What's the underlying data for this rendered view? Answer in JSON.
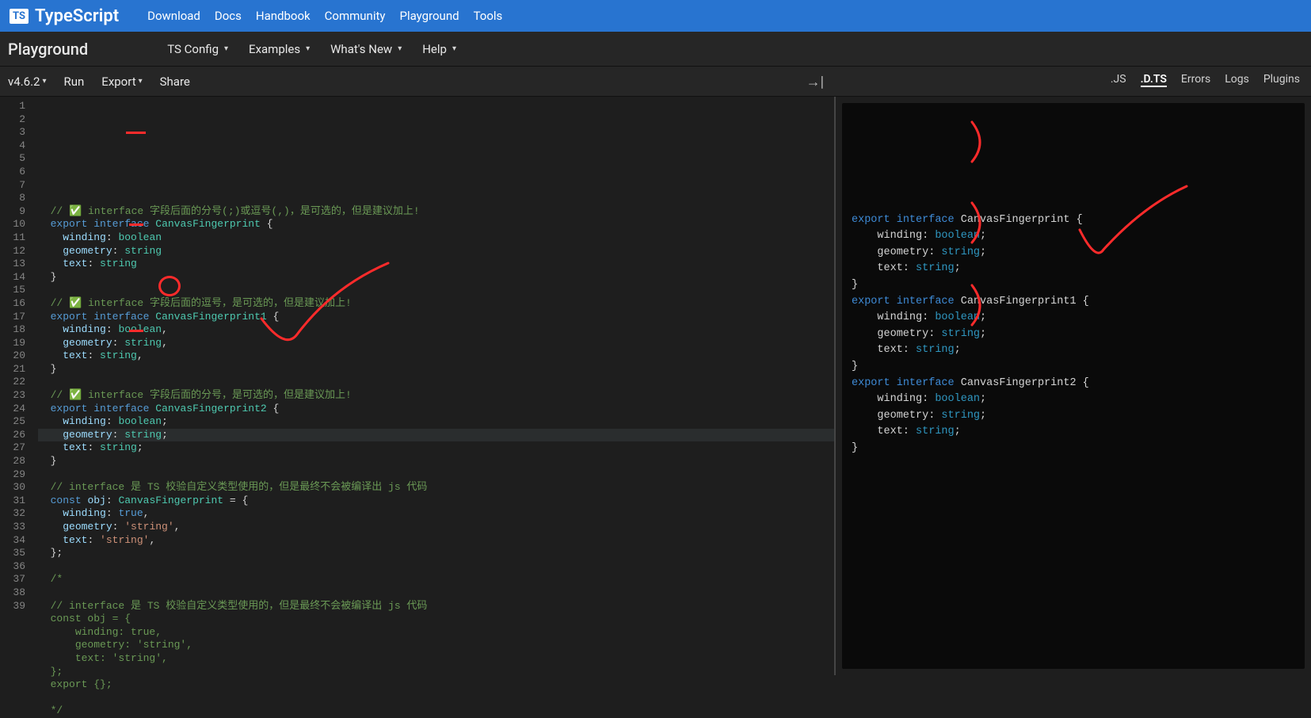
{
  "topnav": {
    "brand": "TypeScript",
    "logo": "TS",
    "links": [
      "Download",
      "Docs",
      "Handbook",
      "Community",
      "Playground",
      "Tools"
    ]
  },
  "subnav": {
    "title": "Playground",
    "items": [
      {
        "label": "TS Config",
        "caret": true
      },
      {
        "label": "Examples",
        "caret": true
      },
      {
        "label": "What's New",
        "caret": true
      },
      {
        "label": "Help",
        "caret": true
      }
    ]
  },
  "toolbar": {
    "version": "v4.6.2",
    "run": "Run",
    "export": "Export",
    "share": "Share"
  },
  "outputTabs": [
    ".JS",
    ".D.TS",
    "Errors",
    "Logs",
    "Plugins"
  ],
  "activeOutputTab": 1,
  "editor": {
    "currentLine": 18,
    "lines": [
      {
        "n": 1,
        "tokens": [
          [
            "  ",
            "p"
          ],
          [
            "// ✅ interface 字段后面的分号(;)或逗号(,)，是可选的，但是建议加上!",
            "comment"
          ]
        ]
      },
      {
        "n": 2,
        "tokens": [
          [
            "  ",
            "p"
          ],
          [
            "export",
            "keyword"
          ],
          [
            " ",
            "p"
          ],
          [
            "interface",
            "keyword"
          ],
          [
            " ",
            "p"
          ],
          [
            "CanvasFingerprint",
            "type"
          ],
          [
            " {",
            "p"
          ]
        ]
      },
      {
        "n": 3,
        "tokens": [
          [
            "    ",
            "p"
          ],
          [
            "winding",
            "prop"
          ],
          [
            ": ",
            "p"
          ],
          [
            "boolean",
            "type"
          ]
        ]
      },
      {
        "n": 4,
        "tokens": [
          [
            "    ",
            "p"
          ],
          [
            "geometry",
            "prop"
          ],
          [
            ": ",
            "p"
          ],
          [
            "string",
            "type"
          ]
        ]
      },
      {
        "n": 5,
        "tokens": [
          [
            "    ",
            "p"
          ],
          [
            "text",
            "prop"
          ],
          [
            ": ",
            "p"
          ],
          [
            "string",
            "type"
          ]
        ]
      },
      {
        "n": 6,
        "tokens": [
          [
            "  }",
            "p"
          ]
        ]
      },
      {
        "n": 7,
        "tokens": [
          [
            "",
            "p"
          ]
        ]
      },
      {
        "n": 8,
        "tokens": [
          [
            "  ",
            "p"
          ],
          [
            "// ✅ interface 字段后面的逗号，是可选的，但是建议加上!",
            "comment"
          ]
        ]
      },
      {
        "n": 9,
        "tokens": [
          [
            "  ",
            "p"
          ],
          [
            "export",
            "keyword"
          ],
          [
            " ",
            "p"
          ],
          [
            "interface",
            "keyword"
          ],
          [
            " ",
            "p"
          ],
          [
            "CanvasFingerprint1",
            "type"
          ],
          [
            " {",
            "p"
          ]
        ]
      },
      {
        "n": 10,
        "tokens": [
          [
            "    ",
            "p"
          ],
          [
            "winding",
            "prop"
          ],
          [
            ": ",
            "p"
          ],
          [
            "boolean",
            "type"
          ],
          [
            ",",
            "p"
          ]
        ]
      },
      {
        "n": 11,
        "tokens": [
          [
            "    ",
            "p"
          ],
          [
            "geometry",
            "prop"
          ],
          [
            ": ",
            "p"
          ],
          [
            "string",
            "type"
          ],
          [
            ",",
            "p"
          ]
        ]
      },
      {
        "n": 12,
        "tokens": [
          [
            "    ",
            "p"
          ],
          [
            "text",
            "prop"
          ],
          [
            ": ",
            "p"
          ],
          [
            "string",
            "type"
          ],
          [
            ",",
            "p"
          ]
        ]
      },
      {
        "n": 13,
        "tokens": [
          [
            "  }",
            "p"
          ]
        ]
      },
      {
        "n": 14,
        "tokens": [
          [
            "",
            "p"
          ]
        ]
      },
      {
        "n": 15,
        "tokens": [
          [
            "  ",
            "p"
          ],
          [
            "// ✅ interface 字段后面的分号，是可选的，但是建议加上!",
            "comment"
          ]
        ]
      },
      {
        "n": 16,
        "tokens": [
          [
            "  ",
            "p"
          ],
          [
            "export",
            "keyword"
          ],
          [
            " ",
            "p"
          ],
          [
            "interface",
            "keyword"
          ],
          [
            " ",
            "p"
          ],
          [
            "CanvasFingerprint2",
            "type"
          ],
          [
            " {",
            "p"
          ]
        ]
      },
      {
        "n": 17,
        "tokens": [
          [
            "    ",
            "p"
          ],
          [
            "winding",
            "prop"
          ],
          [
            ": ",
            "p"
          ],
          [
            "boolean",
            "type"
          ],
          [
            ";",
            "p"
          ]
        ]
      },
      {
        "n": 18,
        "tokens": [
          [
            "    ",
            "p"
          ],
          [
            "geometry",
            "prop"
          ],
          [
            ": ",
            "p"
          ],
          [
            "string",
            "type"
          ],
          [
            ";",
            "p"
          ]
        ]
      },
      {
        "n": 19,
        "tokens": [
          [
            "    ",
            "p"
          ],
          [
            "text",
            "prop"
          ],
          [
            ": ",
            "p"
          ],
          [
            "string",
            "type"
          ],
          [
            ";",
            "p"
          ]
        ]
      },
      {
        "n": 20,
        "tokens": [
          [
            "  }",
            "p"
          ]
        ]
      },
      {
        "n": 21,
        "tokens": [
          [
            "",
            "p"
          ]
        ]
      },
      {
        "n": 22,
        "tokens": [
          [
            "  ",
            "p"
          ],
          [
            "// interface 是 TS 校验自定义类型使用的，但是最终不会被编译出 js 代码",
            "comment"
          ]
        ]
      },
      {
        "n": 23,
        "tokens": [
          [
            "  ",
            "p"
          ],
          [
            "const",
            "keyword"
          ],
          [
            " ",
            "p"
          ],
          [
            "obj",
            "prop"
          ],
          [
            ": ",
            "p"
          ],
          [
            "CanvasFingerprint",
            "type"
          ],
          [
            " = {",
            "p"
          ]
        ]
      },
      {
        "n": 24,
        "tokens": [
          [
            "    ",
            "p"
          ],
          [
            "winding",
            "prop"
          ],
          [
            ": ",
            "p"
          ],
          [
            "true",
            "literal"
          ],
          [
            ",",
            "p"
          ]
        ]
      },
      {
        "n": 25,
        "tokens": [
          [
            "    ",
            "p"
          ],
          [
            "geometry",
            "prop"
          ],
          [
            ": ",
            "p"
          ],
          [
            "'string'",
            "string"
          ],
          [
            ",",
            "p"
          ]
        ]
      },
      {
        "n": 26,
        "tokens": [
          [
            "    ",
            "p"
          ],
          [
            "text",
            "prop"
          ],
          [
            ": ",
            "p"
          ],
          [
            "'string'",
            "string"
          ],
          [
            ",",
            "p"
          ]
        ]
      },
      {
        "n": 27,
        "tokens": [
          [
            "  };",
            "p"
          ]
        ]
      },
      {
        "n": 28,
        "tokens": [
          [
            "",
            "p"
          ]
        ]
      },
      {
        "n": 29,
        "tokens": [
          [
            "  ",
            "p"
          ],
          [
            "/*",
            "comment"
          ]
        ]
      },
      {
        "n": 30,
        "tokens": [
          [
            "",
            "p"
          ]
        ]
      },
      {
        "n": 31,
        "tokens": [
          [
            "  ",
            "p"
          ],
          [
            "// interface 是 TS 校验自定义类型使用的，但是最终不会被编译出 js 代码",
            "comment"
          ]
        ]
      },
      {
        "n": 32,
        "tokens": [
          [
            "  ",
            "p"
          ],
          [
            "const obj = {",
            "comment"
          ]
        ]
      },
      {
        "n": 33,
        "tokens": [
          [
            "      ",
            "p"
          ],
          [
            "winding: true,",
            "comment"
          ]
        ]
      },
      {
        "n": 34,
        "tokens": [
          [
            "      ",
            "p"
          ],
          [
            "geometry: 'string',",
            "comment"
          ]
        ]
      },
      {
        "n": 35,
        "tokens": [
          [
            "      ",
            "p"
          ],
          [
            "text: 'string',",
            "comment"
          ]
        ]
      },
      {
        "n": 36,
        "tokens": [
          [
            "  ",
            "p"
          ],
          [
            "};",
            "comment"
          ]
        ]
      },
      {
        "n": 37,
        "tokens": [
          [
            "  ",
            "p"
          ],
          [
            "export {};",
            "comment"
          ]
        ]
      },
      {
        "n": 38,
        "tokens": [
          [
            "",
            "p"
          ]
        ]
      },
      {
        "n": 39,
        "tokens": [
          [
            "  ",
            "p"
          ],
          [
            "*/",
            "comment"
          ]
        ]
      }
    ]
  },
  "output": {
    "lines": [
      [
        [
          "export",
          "keyword"
        ],
        [
          " ",
          "p"
        ],
        [
          "interface",
          "keyword"
        ],
        [
          " ",
          "p"
        ],
        [
          "CanvasFingerprint",
          "type"
        ],
        [
          " {",
          "p"
        ]
      ],
      [
        [
          "    winding: ",
          "prop"
        ],
        [
          "boolean",
          "builtin"
        ],
        [
          ";",
          "p"
        ]
      ],
      [
        [
          "    geometry: ",
          "prop"
        ],
        [
          "string",
          "builtin"
        ],
        [
          ";",
          "p"
        ]
      ],
      [
        [
          "    text: ",
          "prop"
        ],
        [
          "string",
          "builtin"
        ],
        [
          ";",
          "p"
        ]
      ],
      [
        [
          "}",
          "p"
        ]
      ],
      [
        [
          "export",
          "keyword"
        ],
        [
          " ",
          "p"
        ],
        [
          "interface",
          "keyword"
        ],
        [
          " ",
          "p"
        ],
        [
          "CanvasFingerprint1",
          "type"
        ],
        [
          " {",
          "p"
        ]
      ],
      [
        [
          "    winding: ",
          "prop"
        ],
        [
          "boolean",
          "builtin"
        ],
        [
          ";",
          "p"
        ]
      ],
      [
        [
          "    geometry: ",
          "prop"
        ],
        [
          "string",
          "builtin"
        ],
        [
          ";",
          "p"
        ]
      ],
      [
        [
          "    text: ",
          "prop"
        ],
        [
          "string",
          "builtin"
        ],
        [
          ";",
          "p"
        ]
      ],
      [
        [
          "}",
          "p"
        ]
      ],
      [
        [
          "export",
          "keyword"
        ],
        [
          " ",
          "p"
        ],
        [
          "interface",
          "keyword"
        ],
        [
          " ",
          "p"
        ],
        [
          "CanvasFingerprint2",
          "type"
        ],
        [
          " {",
          "p"
        ]
      ],
      [
        [
          "    winding: ",
          "prop"
        ],
        [
          "boolean",
          "builtin"
        ],
        [
          ";",
          "p"
        ]
      ],
      [
        [
          "    geometry: ",
          "prop"
        ],
        [
          "string",
          "builtin"
        ],
        [
          ";",
          "p"
        ]
      ],
      [
        [
          "    text: ",
          "prop"
        ],
        [
          "string",
          "builtin"
        ],
        [
          ";",
          "p"
        ]
      ],
      [
        [
          "}",
          "p"
        ]
      ]
    ]
  }
}
